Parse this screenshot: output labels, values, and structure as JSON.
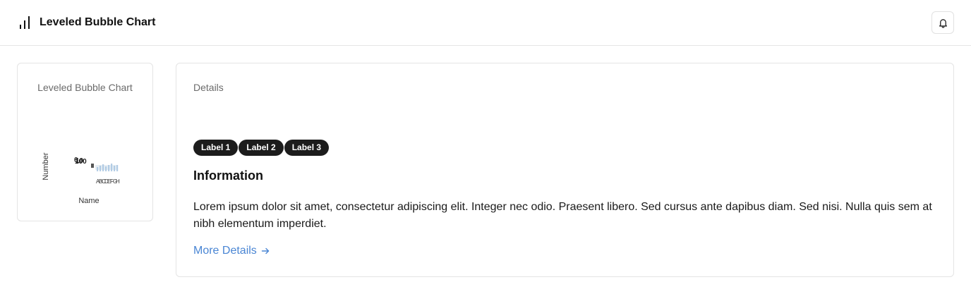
{
  "header": {
    "title": "Leveled Bubble Chart",
    "logo_icon": "bar-chart-icon",
    "notification_icon": "bell-icon"
  },
  "chart_card": {
    "title": "Leveled Bubble Chart"
  },
  "chart_data": {
    "type": "scatter",
    "title": "",
    "xlabel": "Name",
    "ylabel": "Number",
    "x_tick_labels": [
      "A",
      "B",
      "C",
      "D",
      "E",
      "F",
      "G",
      "H"
    ],
    "y_tick_labels": [
      "0",
      "10",
      "100"
    ],
    "series": [
      {
        "values": [
          3,
          5,
          7,
          4,
          6,
          8,
          5,
          6
        ]
      }
    ],
    "colors": {
      "bubble": "#a7c4e0"
    }
  },
  "details": {
    "title": "Details",
    "labels": [
      "Label 1",
      "Label 2",
      "Label 3"
    ],
    "heading": "Information",
    "body": "Lorem ipsum dolor sit amet, consectetur adipiscing elit. Integer nec odio. Praesent libero. Sed cursus ante dapibus diam. Sed nisi. Nulla quis sem at nibh elementum imperdiet.",
    "link_label": "More Details",
    "link_icon": "arrow-right-icon"
  },
  "colors": {
    "link": "#4a86d4",
    "pill_background": "#1c1c1c"
  }
}
